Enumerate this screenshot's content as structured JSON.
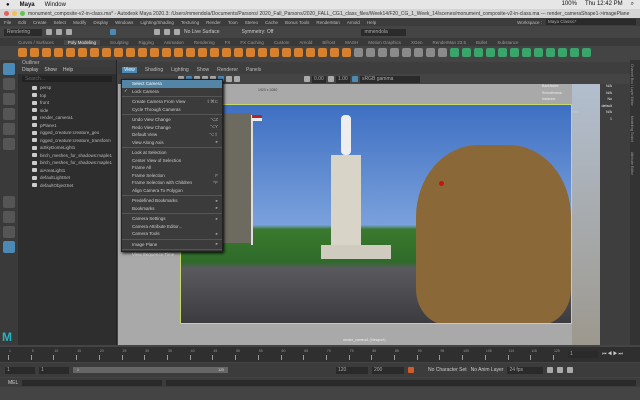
{
  "macos": {
    "app": "Maya",
    "window_menu": "Window",
    "battery": "100%",
    "clock": "Thu 12:42 PM"
  },
  "title": "monument_composite-v2-in-class.ma* - Autodesk Maya 2020.3: /Users/mmendola/Documents/Parsons/ 2020_Fall_Parsons/2020_FALL_CG1_class_files/Week14/F20_CG_1_Week_14/scenes/monument_composite-v2-in-class.ma --- render_cameraShape1->imagePlane",
  "menus": [
    "File",
    "Edit",
    "Create",
    "Select",
    "Modify",
    "Display",
    "Windows",
    "Lighting/Shading",
    "Texturing",
    "Render",
    "Toon",
    "Stereo",
    "Cache",
    "Bonus Tools",
    "RenderMan",
    "Arnold",
    "Help"
  ],
  "workspace": {
    "label": "Workspace :",
    "value": "Maya Classic*"
  },
  "status_line": {
    "menuset": "Rendering",
    "live_surface": "No Live Surface",
    "symmetry": "Symmetry: Off",
    "user": "mmendola"
  },
  "shelf_tabs": [
    "Curves / Surfaces",
    "Poly Modeling",
    "Sculpting",
    "Rigging",
    "Animation",
    "Rendering",
    "FX",
    "FX Caching",
    "Custom",
    "Arnold",
    "Bifrost",
    "MASH",
    "Motion Graphics",
    "XGen",
    "RenderMan 23.5",
    "Bullet",
    "Substance"
  ],
  "shelf_active": "Poly Modeling",
  "outliner": {
    "title": "Outliner",
    "menu": [
      "Display",
      "Show",
      "Help"
    ],
    "search_placeholder": "Search...",
    "items": [
      "persp",
      "top",
      "front",
      "side",
      "render_camera1",
      "pPlane1",
      "rigged_creature:creature_geo",
      "rigged_creature:creature_transform",
      "aiSkyDomeLight1",
      "birch_meshes_for_shadows:maple1",
      "birch_meshes_for_shadows:maple1",
      "aiAreaLight1",
      "defaultLightSet",
      "defaultObjectSet"
    ]
  },
  "panel_menu": [
    "View",
    "Shading",
    "Lighting",
    "Show",
    "Renderer",
    "Panels"
  ],
  "viewport_toolbar": {
    "exposure": "0.00",
    "gamma": "1.00",
    "color_space": "sRGB gamma"
  },
  "viewport": {
    "resolution": "1920 x 1080",
    "camera_label": "render_camera1 (Viewport)"
  },
  "hud": [
    [
      "Backfaces:",
      "N/A"
    ],
    [
      "Smoothness:",
      "N/A"
    ],
    [
      "Instance:",
      "No"
    ],
    [
      "Display Layer:",
      "default"
    ],
    [
      "Distance From Camera:",
      "N/A"
    ],
    [
      "Selected Objects:",
      "1"
    ]
  ],
  "view_menu": [
    {
      "label": "Select Camera",
      "highlight": true
    },
    {
      "label": "Lock Camera",
      "checked": true
    },
    {
      "sep": true
    },
    {
      "label": "Create Camera From View",
      "shortcut": "⇧⌘C"
    },
    {
      "label": "Cycle Through Cameras"
    },
    {
      "sep": true
    },
    {
      "label": "Undo View Change",
      "shortcut": "⌥Z"
    },
    {
      "label": "Redo View Change",
      "shortcut": "⌥Y"
    },
    {
      "label": "Default View",
      "shortcut": "⌥⇧"
    },
    {
      "label": "View Along Axis",
      "sub": true
    },
    {
      "sep": true
    },
    {
      "label": "Look at Selection"
    },
    {
      "label": "Center View of Selection"
    },
    {
      "label": "Frame All"
    },
    {
      "label": "Frame Selection",
      "shortcut": "F"
    },
    {
      "label": "Frame Selection with Children",
      "shortcut": "^F"
    },
    {
      "label": "Align Camera To Polygon"
    },
    {
      "sep": true
    },
    {
      "label": "Predefined Bookmarks",
      "sub": true
    },
    {
      "label": "Bookmarks",
      "sub": true
    },
    {
      "sep": true
    },
    {
      "label": "Camera Settings",
      "sub": true
    },
    {
      "label": "Camera Attribute Editor..."
    },
    {
      "label": "Camera Tools",
      "sub": true
    },
    {
      "sep": true
    },
    {
      "label": "Image Plane",
      "sub": true
    },
    {
      "sep": true
    },
    {
      "label": "View Sequence Time"
    }
  ],
  "right_tabs": [
    "Channel Box / Layer Editor",
    "Modelling Toolkit",
    "Attribute Editor"
  ],
  "timeline": {
    "ticks": [
      "1",
      "5",
      "10",
      "15",
      "20",
      "25",
      "30",
      "35",
      "40",
      "45",
      "50",
      "55",
      "60",
      "65",
      "70",
      "75",
      "80",
      "85",
      "90",
      "95",
      "100",
      "105",
      "110",
      "115",
      "120"
    ],
    "current": "1"
  },
  "range": {
    "start": "1",
    "playback_start": "1",
    "slider_start": "1",
    "slider_end": "120",
    "playback_end": "120",
    "end": "200",
    "character_set": "No Character Set",
    "anim_layer": "No Anim Layer",
    "fps": "24 fps"
  },
  "mel_label": "MEL"
}
